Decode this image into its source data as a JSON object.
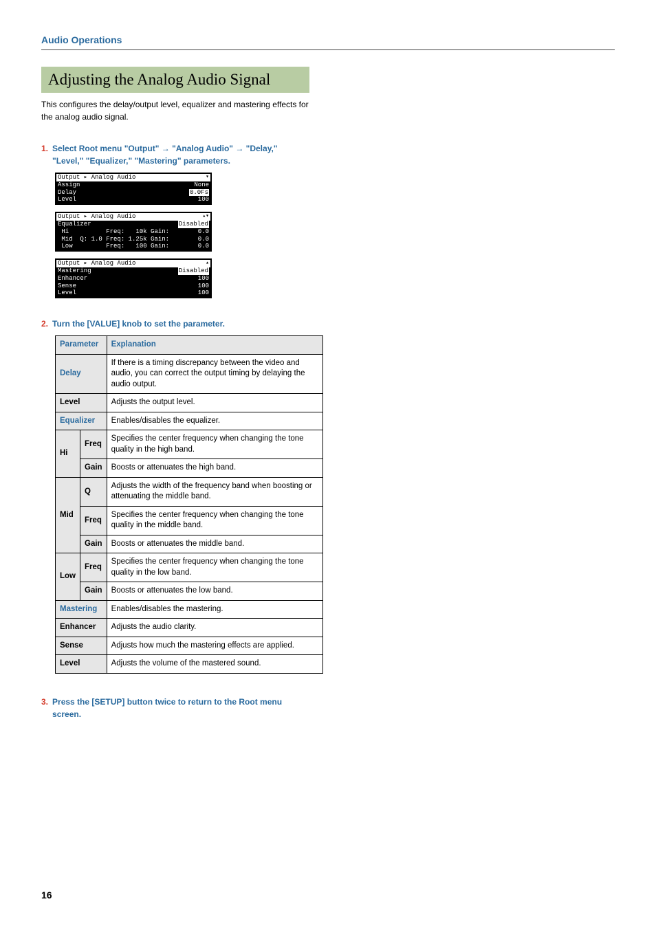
{
  "header": "Audio Operations",
  "section_title": "Adjusting the Analog Audio Signal",
  "intro": "This configures the delay/output level, equalizer and mastering effects for the analog audio signal.",
  "steps": {
    "s1_num": "1.",
    "s1_text": "Select Root menu \"Output\" → \"Analog Audio\" → \"Delay,\" \"Level,\" \"Equalizer,\" \"Mastering\" parameters.",
    "s2_num": "2.",
    "s2_text": "Turn the [VALUE] knob to set the parameter.",
    "s3_num": "3.",
    "s3_text": "Press the [SETUP] button twice to return to the Root menu screen."
  },
  "lcd1": {
    "crumb": "Output ▸ Analog Audio",
    "arrow": "▾",
    "rows": [
      {
        "l": "Assign",
        "r": "None"
      },
      {
        "l": "Delay",
        "r_boxed": "0.0Fs"
      },
      {
        "l": "Level",
        "r": "100"
      }
    ]
  },
  "lcd2": {
    "crumb": "Output ▸ Analog Audio",
    "arrow": "▴▾",
    "rows": [
      {
        "l": "Equalizer",
        "r_hl": "Disabled"
      },
      {
        "l": " Hi          Freq:   10k Gain:",
        "r": "0.0"
      },
      {
        "l": " Mid  Q: 1.0 Freq: 1.25k Gain:",
        "r": "0.0"
      },
      {
        "l": " Low         Freq:   100 Gain:",
        "r": "0.0"
      }
    ]
  },
  "lcd3": {
    "crumb": "Output ▸ Analog Audio",
    "arrow": "▴",
    "rows": [
      {
        "l": "Mastering",
        "r_hl": "Disabled"
      },
      {
        "l": " Enhancer",
        "r": "100"
      },
      {
        "l": " Sense",
        "r": "100"
      },
      {
        "l": " Level",
        "r": "100"
      }
    ]
  },
  "table": {
    "h1": "Parameter",
    "h2": "Explanation",
    "delay": {
      "p": "Delay",
      "e": "If there is a timing discrepancy between the video and audio, you can correct the output timing by delaying the audio output."
    },
    "level1": {
      "p": "Level",
      "e": "Adjusts the output level."
    },
    "equalizer": {
      "p": "Equalizer",
      "e": "Enables/disables the equalizer."
    },
    "hi": {
      "p": "Hi",
      "freq_l": "Freq",
      "freq_e": "Specifies the center frequency when changing the tone quality in the high band.",
      "gain_l": "Gain",
      "gain_e": "Boosts or attenuates the high band."
    },
    "mid": {
      "p": "Mid",
      "q_l": "Q",
      "q_e": "Adjusts the width of the frequency band when boosting or attenuating the middle band.",
      "freq_l": "Freq",
      "freq_e": "Specifies the center frequency when changing the tone quality in the middle band.",
      "gain_l": "Gain",
      "gain_e": "Boosts or attenuates the middle band."
    },
    "low": {
      "p": "Low",
      "freq_l": "Freq",
      "freq_e": "Specifies the center frequency when changing the tone quality in the low band.",
      "gain_l": "Gain",
      "gain_e": "Boosts or attenuates the low band."
    },
    "mastering": {
      "p": "Mastering",
      "e": "Enables/disables the mastering."
    },
    "enhancer": {
      "p": "Enhancer",
      "e": "Adjusts the audio clarity."
    },
    "sense": {
      "p": "Sense",
      "e": "Adjusts how much the mastering effects are applied."
    },
    "level2": {
      "p": "Level",
      "e": "Adjusts the volume of the mastered sound."
    }
  },
  "page_number": "16"
}
